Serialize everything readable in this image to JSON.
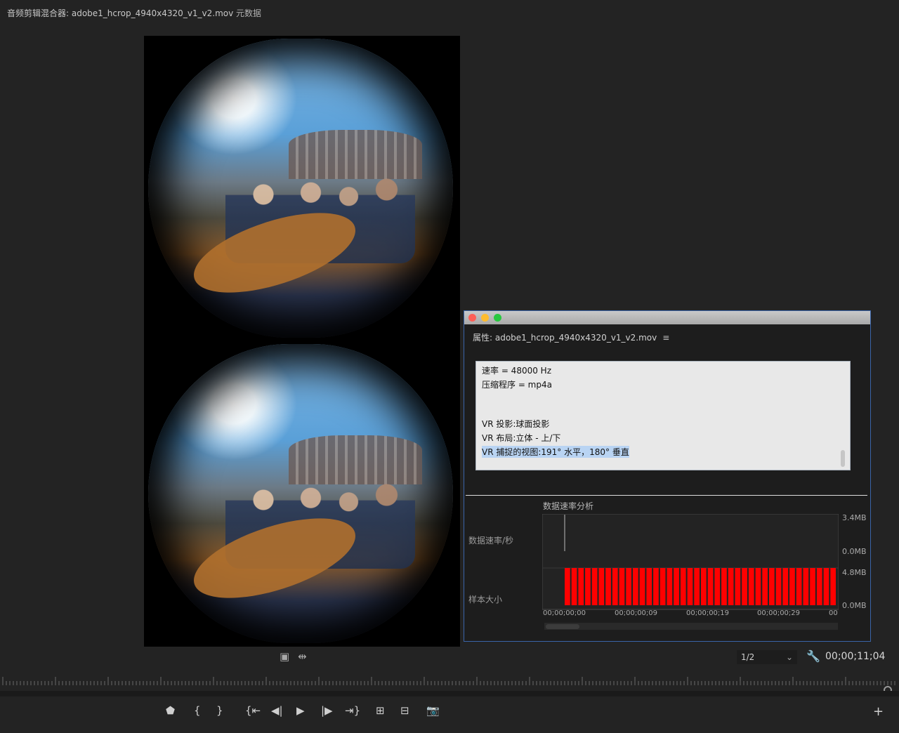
{
  "tabs": {
    "audio_mixer": "音频剪辑混合器: adobe1_hcrop_4940x4320_v1_v2.mov",
    "metadata": "元数据"
  },
  "properties": {
    "header": "属性: adobe1_hcrop_4940x4320_v1_v2.mov",
    "menu_icon": "≡",
    "lines": [
      "速率 = 48000 Hz",
      "压缩程序 = mp4a",
      "VR 投影:球面投影",
      "VR 布局:立体 - 上/下",
      "VR 捕捉的视图:191° 水平，180° 垂直"
    ],
    "chart": {
      "title": "数据速率分析",
      "row1_label": "数据速率/秒",
      "row2_label": "样本大小",
      "y_top_max": "3.4MB",
      "y_top_min": "0.0MB",
      "y_bot_max": "4.8MB",
      "y_bot_min": "0.0MB",
      "x_ticks": [
        "00;00;00;00",
        "00;00;00;09",
        "00;00;00;19",
        "00;00;00;29",
        "00"
      ],
      "bar_color": "#ff0000"
    }
  },
  "chart_data": {
    "type": "bar",
    "title": "数据速率分析",
    "series": [
      {
        "name": "数据速率/秒",
        "values": [
          3.4
        ]
      },
      {
        "name": "样本大小",
        "values": [
          4.8,
          4.8,
          4.8,
          4.8,
          4.8,
          4.8,
          4.8,
          4.8,
          4.8,
          4.8,
          4.8,
          4.8,
          4.8,
          4.8,
          4.8,
          4.8,
          4.8,
          4.8,
          4.8,
          4.8,
          4.8,
          4.8,
          4.8,
          4.8,
          4.8,
          4.8,
          4.8,
          4.8,
          4.8,
          4.8,
          4.8,
          4.8,
          4.8,
          4.8,
          4.8,
          4.8,
          4.8,
          4.8,
          4.8,
          4.8
        ]
      }
    ],
    "x_ticks": [
      "00;00;00;00",
      "00;00;00;09",
      "00;00;00;19",
      "00;00;00;29"
    ],
    "y_ranges": {
      "数据速率/秒": [
        "0.0MB",
        "3.4MB"
      ],
      "样本大小": [
        "0.0MB",
        "4.8MB"
      ]
    },
    "grid": false
  },
  "monitor": {
    "resolution": "1/2",
    "timecode": "00;00;11;04"
  },
  "icons": {
    "safe_margins": "▣",
    "spread": "⇹",
    "wrench": "🔧",
    "marker": "⬟",
    "mark_in": "{",
    "mark_out": "}",
    "go_in": "{⇤",
    "step_back": "◀|",
    "play": "▶",
    "step_fwd": "|▶",
    "go_out": "⇥}",
    "insert": "⊞",
    "overwrite": "⊟",
    "export_frame": "📷",
    "add": "+",
    "chevron": "⌄"
  }
}
